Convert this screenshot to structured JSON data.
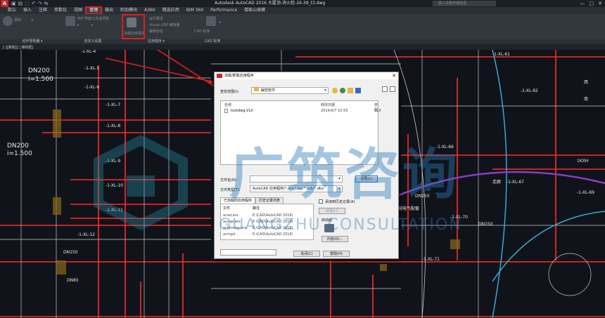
{
  "window": {
    "app_icon": "A",
    "title": "Autodesk AutoCAD 2016    大厦顶-消火栓-26-39_t3.dwg",
    "search_placeholder": "键入关键字或短语",
    "quick_access": [
      "▣",
      "▤",
      "⬚",
      "↶",
      "↷",
      "⇆"
    ],
    "minimize": "—",
    "maximize": "□",
    "close": "✕"
  },
  "ribbon_tabs": [
    "默认",
    "插入",
    "注释",
    "参数化",
    "视图",
    "管理",
    "输出",
    "附加模块",
    "A360",
    "精选应用",
    "BIM 360",
    "Performance",
    "楼板山坡模"
  ],
  "active_tab_index": 5,
  "ribbon_buttons": [
    "录制",
    "▸",
    "用户界面",
    "▸",
    "工具选项板",
    "▸",
    "加载应用程序",
    "运行脚本",
    "Visual LISP 编辑器",
    "编辑别名",
    "CAD 标准",
    "▸"
  ],
  "panel_labels": [
    "动作录制器 ▾",
    "自定义设置",
    "应用程序 ▾",
    "CAD 标准"
  ],
  "file_tab": "[-][俯视][二维线框]",
  "dialog": {
    "title": "加载/卸载应用程序",
    "close": "✕",
    "look_in_label": "查找范围(I):",
    "look_in_value": "解密软件",
    "columns": {
      "name": "名称",
      "modified": "修改日期",
      "type": "类型"
    },
    "files": [
      {
        "name": "lockdwg.VLX",
        "modified": "2014/9/7 10:55",
        "type": "VLX"
      }
    ],
    "filename_label": "文件名(N):",
    "filename_value": "",
    "load_button": "加载(L)",
    "filetype_label": "文件类型(T):",
    "filetype_value": "AutoCAD 应用程序(*.arx;*.lsp;*.dvb;*.dbx",
    "history_checkbox": "添加到历史记录(A)",
    "loaded_apps_tab": "已加载的应用程序",
    "history_tab": "历史记录列表",
    "applist_headers": {
      "file": "文件",
      "path": "路径"
    },
    "loaded_apps": [
      {
        "file": "acad.arx",
        "path": "E:\\CAD\\AutoCAD 2016\\"
      },
      {
        "file": "acapp.arx",
        "path": "E:\\CAD\\AutoCAD 2016\\"
      },
      {
        "file": "acbrowse.arx",
        "path": "E:\\CAD\\AutoCAD 2016\\"
      },
      {
        "file": "acmgd...",
        "path": "E:\\CAD\\AutoCAD 2016\\"
      }
    ],
    "unload_button": "卸载(U)",
    "startup_label": "启动组",
    "contents_button": "内容(O)...",
    "close_button": "关闭(C)",
    "help_button": "帮助(H)"
  },
  "watermark": {
    "text_cn": "广筑咨询",
    "text_en": "GUANGZHU CONSULTATION"
  },
  "drawing_labels": [
    "DN200",
    "i=1.500",
    "DN200",
    "i=1.500",
    "-1-XL-4",
    "-1-XL-5",
    "-1-XL-6",
    "-1-XL-7",
    "-1-XL-8",
    "-1-XL-9",
    "-1-XL-10",
    "-1-XL-11",
    "-1-XL-12",
    "-1-XL-61",
    "-1-XL-62",
    "-1-XL-66",
    "-1-XL-67",
    "-1-XL-69",
    "-1-XL-70",
    "-1-XL-71",
    "DN150",
    "DN150",
    "DN150",
    "DN65",
    "1KXH",
    "走廊",
    "机械电气配套",
    "西",
    "南"
  ],
  "colors": {
    "accent_red": "#e01e1e",
    "watermark": "#2a6fa0",
    "cad_bg": "#10141a"
  }
}
